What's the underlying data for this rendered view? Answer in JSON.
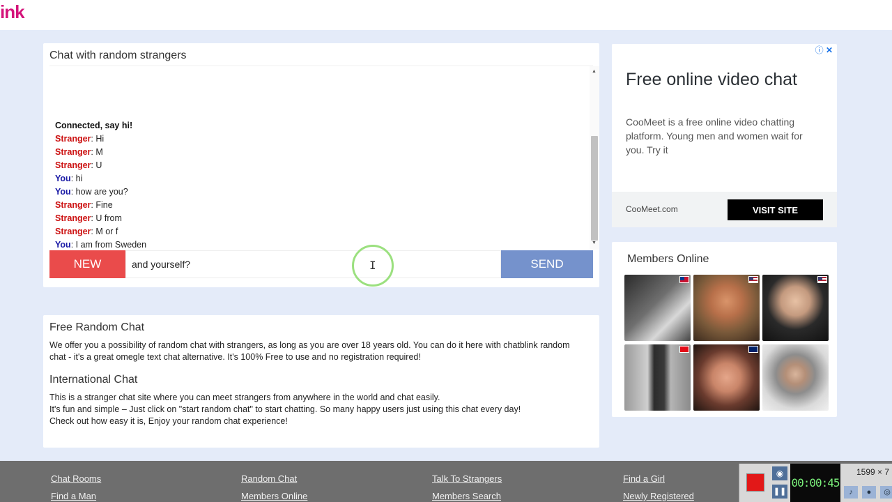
{
  "header": {
    "logo_text": "ink"
  },
  "chat": {
    "title": "Chat with random strangers",
    "messages": [
      {
        "type": "status",
        "text": "Connected, say hi!"
      },
      {
        "who": "Stranger",
        "text": ": Hi"
      },
      {
        "who": "Stranger",
        "text": ": M"
      },
      {
        "who": "Stranger",
        "text": ": U"
      },
      {
        "who": "You",
        "text": ": hi"
      },
      {
        "who": "You",
        "text": ": how are you?"
      },
      {
        "who": "Stranger",
        "text": ": Fine"
      },
      {
        "who": "Stranger",
        "text": ": U from"
      },
      {
        "who": "Stranger",
        "text": ": M or f"
      },
      {
        "who": "You",
        "text": ": I am from Sweden"
      }
    ],
    "new_label": "NEW",
    "input_value": "and yourself?",
    "send_label": "SEND"
  },
  "ad": {
    "title": "Free online video chat",
    "text": "CooMeet is a free online video chatting platform. Young men and women wait for you. Try it",
    "domain": "CooMeet.com",
    "visit_label": "VISIT SITE",
    "info_icon": "ⓘ",
    "close_icon": "✕"
  },
  "members": {
    "title": "Members Online",
    "avatars": [
      {
        "name": "avatar-1",
        "flag": "taiwan"
      },
      {
        "name": "avatar-2",
        "flag": "usa"
      },
      {
        "name": "avatar-3",
        "flag": "usa"
      },
      {
        "name": "avatar-4",
        "flag": "turkey"
      },
      {
        "name": "avatar-5",
        "flag": "australia"
      },
      {
        "name": "avatar-6",
        "flag": ""
      }
    ]
  },
  "info": {
    "heading1": "Free Random Chat",
    "para1": "We offer you a possibility of random chat with strangers, as long as you are over 18 years old. You can do it here with chatblink random chat - it's a great omegle text chat alternative. It's 100% Free to use and no registration required!",
    "heading2": "International Chat",
    "para2_line1": "This is a stranger chat site where you can meet strangers from anywhere in the world and chat easily.",
    "para2_line2": "It's fun and simple – Just click on \"start random chat\" to start chatting. So many happy users just using this chat every day!",
    "para2_line3": "Check out how easy it is, Enjoy your random chat experience!"
  },
  "footer": {
    "links": [
      "Chat Rooms",
      "Random Chat",
      "Talk To Strangers",
      "Find a Girl",
      "Find a Man",
      "Members Online",
      "Members Search",
      "Newly Registered"
    ]
  },
  "recorder": {
    "time": "00:00:45",
    "resolution": "1599 × 7"
  }
}
